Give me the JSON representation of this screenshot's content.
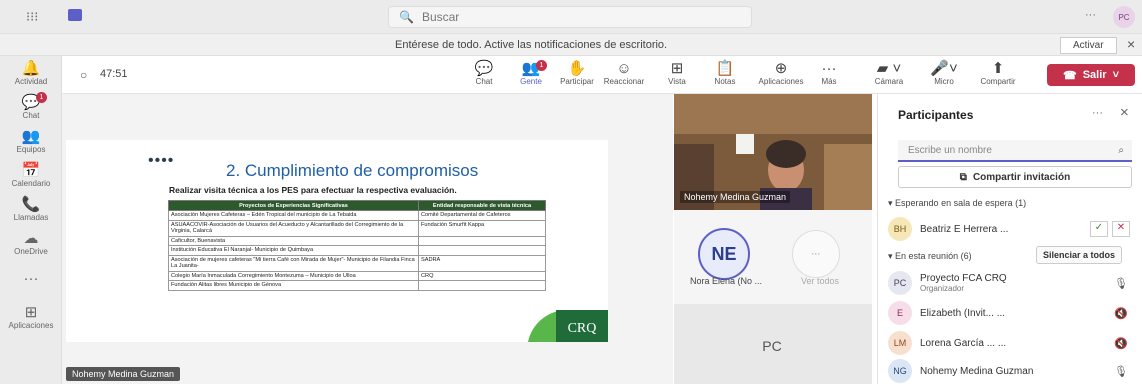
{
  "topbar": {
    "search_placeholder": "Buscar",
    "more": "···",
    "user_initials": "PC"
  },
  "notification": {
    "text": "Entérese de todo. Active las notificaciones de escritorio.",
    "button": "Activar",
    "close": "×"
  },
  "rail": [
    {
      "label": "Actividad",
      "icon": "bell-icon",
      "glyph": "🔔"
    },
    {
      "label": "Chat",
      "icon": "chat-icon",
      "glyph": "💬",
      "badge": "1"
    },
    {
      "label": "Equipos",
      "icon": "teams-icon",
      "glyph": "👥"
    },
    {
      "label": "Calendario",
      "icon": "calendar-icon",
      "glyph": "📅"
    },
    {
      "label": "Llamadas",
      "icon": "phone-icon",
      "glyph": "📞"
    },
    {
      "label": "OneDrive",
      "icon": "cloud-icon",
      "glyph": "☁"
    },
    {
      "label": "",
      "icon": "more-apps-icon",
      "glyph": "···"
    },
    {
      "label": "Aplicaciones",
      "icon": "apps-icon",
      "glyph": "⊞"
    }
  ],
  "meeting": {
    "timer": "47:51",
    "tools": [
      {
        "label": "Chat",
        "icon": "chat-icon",
        "glyph": "💬"
      },
      {
        "label": "Gente",
        "icon": "people-icon",
        "glyph": "👥",
        "badge": "1"
      },
      {
        "label": "Participar",
        "icon": "hand-icon",
        "glyph": "✋"
      },
      {
        "label": "Reaccionar",
        "icon": "emoji-icon",
        "glyph": "☺"
      },
      {
        "label": "Vista",
        "icon": "grid-icon",
        "glyph": "⊞"
      },
      {
        "label": "Notas",
        "icon": "notes-icon",
        "glyph": "📋"
      },
      {
        "label": "Aplicaciones",
        "icon": "add-icon",
        "glyph": "⊕"
      },
      {
        "label": "Más",
        "icon": "more-icon",
        "glyph": "···"
      }
    ],
    "camera": "Cámara",
    "mic": "Micro",
    "share": "Compartir",
    "leave": "Salir"
  },
  "slide": {
    "dots": "••••",
    "title": "2. Cumplimiento de compromisos",
    "subtitle": "Realizar visita técnica a los PES para efectuar la respectiva evaluación.",
    "headers": [
      "Proyectos de Experiencias Significativas",
      "Entidad responsable de vista técnica"
    ],
    "rows": [
      [
        "Asociación Mujeres Cafeteras – Edén Tropical del municipio de La Tebaida",
        "Comité Departamental de Cafeteros"
      ],
      [
        "ASUAACOVIR-Asociación de Usuarios del Acueducto y Alcantarillado del Corregimiento de la Virginia, Calarcá",
        "Fundación Smurfit Kappa"
      ],
      [
        "Caficultor, Buenavista",
        ""
      ],
      [
        "Institución Educativa El Naranjal- Municipio de Quimbaya",
        ""
      ],
      [
        "Asociación de mujeres cafeteras \"Mi tierra Café con Mirada de Mujer\"- Municipio de Filandia Finca La Juanita-",
        "SADRA"
      ],
      [
        "Colegio María Inmaculada Corregimiento Montezuma – Municipio de Ulloa",
        "CRQ"
      ],
      [
        "Fundación Alitas libres Municipio de Génova",
        ""
      ]
    ],
    "logo": "CRQ"
  },
  "presenter_name": "Nohemy Medina Guzman",
  "video": {
    "name": "Nohemy Medina Guzman"
  },
  "tiles": [
    {
      "initials": "NE",
      "name": "Nora Elena (No ..."
    },
    {
      "initials": "···",
      "name": "Ver todos"
    },
    {
      "initials": "PC",
      "name": ""
    }
  ],
  "panel": {
    "title": "Participantes",
    "search_placeholder": "Escribe un nombre",
    "share_invite": "Compartir invitación",
    "waiting_header": "Esperando en sala de espera (1)",
    "waiting": [
      {
        "initials": "BH",
        "name": "Beatriz E Herrera ...",
        "color": "#f6e7b8"
      }
    ],
    "in_meeting_header": "En esta reunión (6)",
    "mute_all": "Silenciar a todos",
    "people": [
      {
        "initials": "PC",
        "name": "Proyecto FCA CRQ",
        "role": "Organizador",
        "color": "#e5e8f0"
      },
      {
        "initials": "E",
        "name": "Elizabeth (Invit... ...",
        "role": "",
        "color": "#f7dde8"
      },
      {
        "initials": "LM",
        "name": "Lorena García ... ...",
        "role": "",
        "color": "#f8e0cf"
      },
      {
        "initials": "NG",
        "name": "Nohemy Medina Guzman",
        "role": "",
        "color": "#dbe6f4"
      }
    ]
  }
}
